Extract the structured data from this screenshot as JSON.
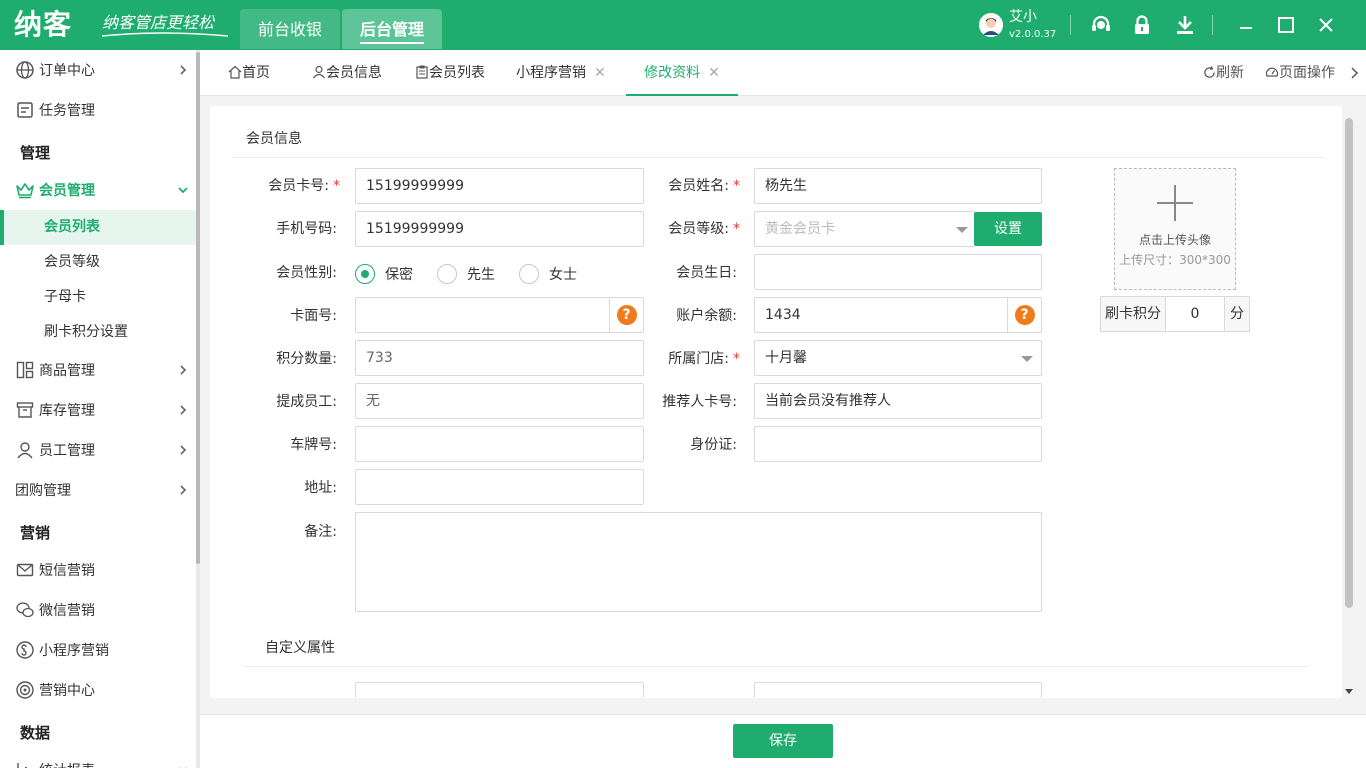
{
  "app": {
    "logo": "纳客",
    "slogan": "纳客管店更轻松",
    "top_tabs": [
      "前台收银",
      "后台管理"
    ],
    "user_name": "艾小",
    "version": "v2.0.0.37",
    "brand_color": "#1fad6f"
  },
  "sidebar": {
    "items": [
      {
        "label": "订单中心",
        "icon": "globe-icon"
      },
      {
        "label": "任务管理",
        "icon": "task-icon"
      },
      {
        "label": "会员管理",
        "icon": "crown-icon"
      },
      {
        "label": "商品管理",
        "icon": "grid-icon"
      },
      {
        "label": "库存管理",
        "icon": "box-icon"
      },
      {
        "label": "员工管理",
        "icon": "user-icon"
      },
      {
        "label": "团购管理"
      },
      {
        "label": "短信营销",
        "icon": "mail-icon"
      },
      {
        "label": "微信营销",
        "icon": "wechat-icon"
      },
      {
        "label": "小程序营销",
        "icon": "miniprogram-icon"
      },
      {
        "label": "营销中心",
        "icon": "target-icon"
      },
      {
        "label": "统计报表",
        "icon": "chart-icon"
      }
    ],
    "sections": [
      "管理",
      "营销",
      "数据"
    ],
    "member_sub": [
      "会员列表",
      "会员等级",
      "子母卡",
      "刷卡积分设置"
    ]
  },
  "tabs": {
    "home": "首页",
    "member_info": "会员信息",
    "member_list": "会员列表",
    "mini_marketing": "小程序营销",
    "edit_profile": "修改资料",
    "refresh": "刷新",
    "page_ops": "页面操作"
  },
  "form": {
    "section_title": "会员信息",
    "card_no_label": "会员卡号:",
    "card_no": "15199999999",
    "name_label": "会员姓名:",
    "name": "杨先生",
    "phone_label": "手机号码:",
    "phone": "15199999999",
    "level_label": "会员等级:",
    "level": "黄金会员卡",
    "set_button": "设置",
    "gender_label": "会员性别:",
    "gender_options": [
      "保密",
      "先生",
      "女士"
    ],
    "gender_selected": "保密",
    "birthday_label": "会员生日:",
    "birthday": "",
    "card_face_label": "卡面号:",
    "card_face": "",
    "balance_label": "账户余额:",
    "balance": "1434",
    "points_label": "积分数量:",
    "points": "733",
    "store_label": "所属门店:",
    "store": "十月馨",
    "commission_label": "提成员工:",
    "commission_staff": "无",
    "referrer_label": "推荐人卡号:",
    "referrer": "当前会员没有推荐人",
    "plate_label": "车牌号:",
    "plate": "",
    "idcard_label": "身份证:",
    "idcard": "",
    "address_label": "地址:",
    "address": "",
    "remark_label": "备注:",
    "remark": "",
    "custom_title": "自定义属性"
  },
  "upload": {
    "title": "点击上传头像",
    "size_hint": "上传尺寸：300*300"
  },
  "swipe_points": {
    "label": "刷卡积分",
    "value": "0",
    "unit": "分"
  },
  "footer": {
    "save": "保存"
  }
}
